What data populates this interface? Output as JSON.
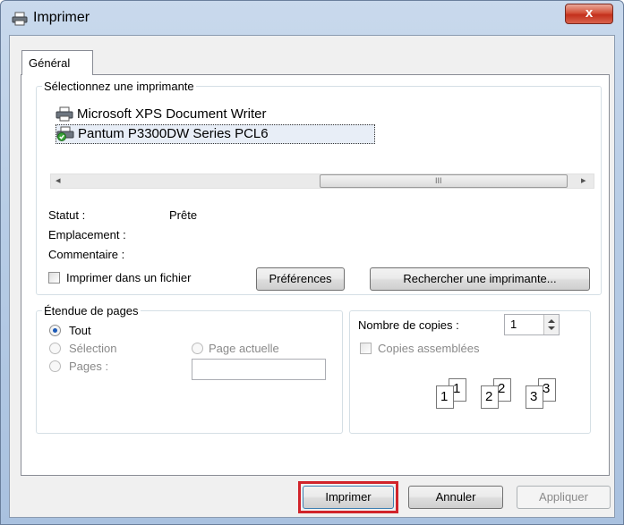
{
  "window": {
    "title": "Imprimer",
    "close_glyph": "x"
  },
  "tabs": [
    {
      "label": "Général"
    }
  ],
  "printer_group": {
    "label": "Sélectionnez une imprimante",
    "printers": [
      {
        "name": "Microsoft XPS Document Writer",
        "icon": "printer-icon"
      },
      {
        "name": "Pantum P3300DW Series PCL6",
        "icon": "printer-default-icon",
        "selected": true
      }
    ],
    "scroll_left": "◂",
    "scroll_right": "▸",
    "scroll_thumb": "III"
  },
  "status": {
    "statut_label": "Statut :",
    "statut_value": "Prête",
    "emplacement_label": "Emplacement :",
    "commentaire_label": "Commentaire :"
  },
  "print_to_file": {
    "label": "Imprimer dans un fichier",
    "checked": false
  },
  "buttons_mid": {
    "preferences": "Préférences",
    "find_printer": "Rechercher une imprimante..."
  },
  "page_range": {
    "label": "Étendue de pages",
    "options": {
      "all": "Tout",
      "selection": "Sélection",
      "current": "Page actuelle",
      "pages": "Pages :"
    },
    "selected": "all",
    "pages_value": ""
  },
  "copies": {
    "label": "Nombre de copies :",
    "value": "1",
    "collate_label": "Copies assemblées",
    "collate_checked": false,
    "collate_digits": [
      "1",
      "1",
      "2",
      "2",
      "3",
      "3"
    ]
  },
  "footer": {
    "print": "Imprimer",
    "cancel": "Annuler",
    "apply": "Appliquer"
  }
}
